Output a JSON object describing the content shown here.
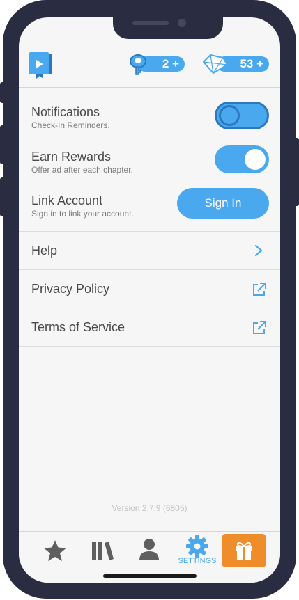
{
  "header": {
    "logo_icon": "book-play-icon",
    "keys": {
      "icon": "key-icon",
      "value": "2 +"
    },
    "gems": {
      "icon": "diamond-icon",
      "value": "53 +"
    }
  },
  "settings": {
    "notifications": {
      "title": "Notifications",
      "subtitle": "Check-In Reminders.",
      "enabled": false
    },
    "rewards": {
      "title": "Earn Rewards",
      "subtitle": "Offer ad after each chapter.",
      "enabled": true
    },
    "account": {
      "title": "Link Account",
      "subtitle": "Sign in to link your account.",
      "button": "Sign In"
    }
  },
  "links": [
    {
      "label": "Help",
      "icon": "chevron-right-icon"
    },
    {
      "label": "Privacy Policy",
      "icon": "external-link-icon"
    },
    {
      "label": "Terms of Service",
      "icon": "external-link-icon"
    }
  ],
  "version": "Version 2.7.9 (6805)",
  "tabbar": {
    "tabs": [
      "star-icon",
      "library-icon",
      "profile-icon",
      "gear-icon",
      "gift-icon"
    ],
    "active_label": "SETTINGS"
  },
  "colors": {
    "accent": "#4aa8ee",
    "gift": "#ee8d2a",
    "frame": "#2a2c41"
  }
}
